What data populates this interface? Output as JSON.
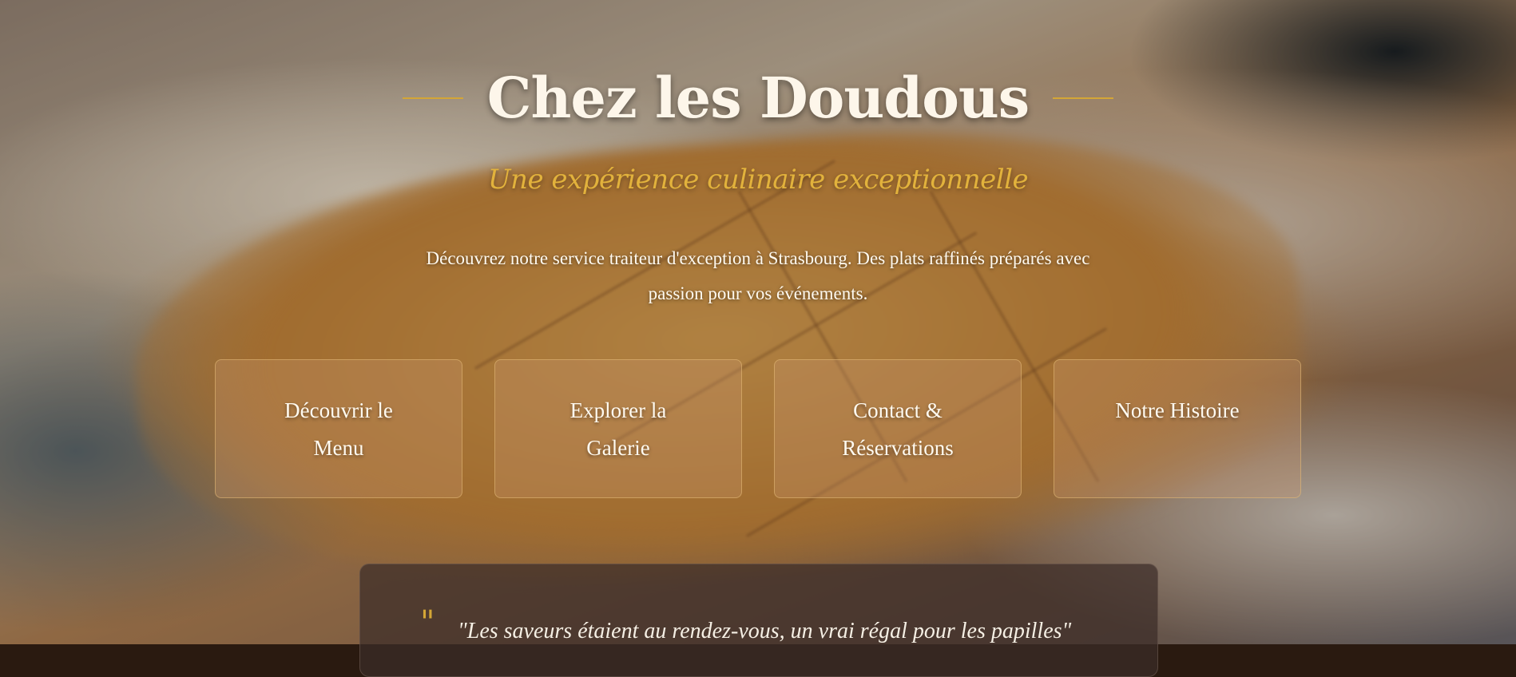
{
  "hero": {
    "title": "Chez les Doudous",
    "subtitle": "Une expérience culinaire exceptionnelle",
    "description": "Découvrez notre service traiteur d'exception à Strasbourg. Des plats raffinés préparés avec passion pour vos événements."
  },
  "nav_cards": [
    {
      "label": "Découvrir le Menu"
    },
    {
      "label": "Explorer la Galerie"
    },
    {
      "label": "Contact & Réservations"
    },
    {
      "label": "Notre Histoire"
    }
  ],
  "testimonial": {
    "quote_mark": "\"",
    "text": "\"Les saveurs étaient au rendez-vous, un vrai régal pour les papilles\""
  },
  "colors": {
    "accent_gold": "#d4a636",
    "title_text": "#fdf6ea"
  }
}
